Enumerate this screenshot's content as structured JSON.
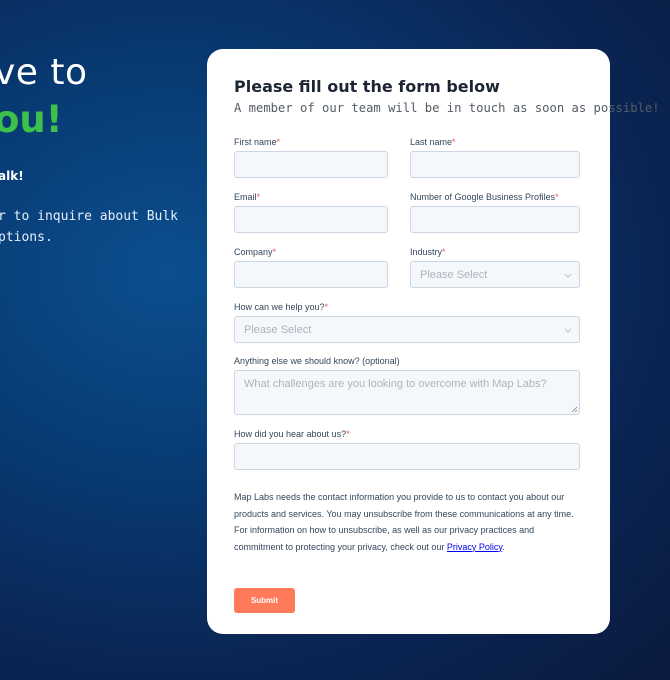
{
  "hero": {
    "line1": "ve to",
    "line2": "ou!",
    "subheading": "alk!",
    "description_line1": "r to inquire about Bulk",
    "description_line2": "ptions."
  },
  "form": {
    "title": "Please fill out the form below",
    "subtitle": "A member of our team will be in touch as soon as possible!",
    "required_marker": "*",
    "fields": {
      "first_name": {
        "label": "First name",
        "value": ""
      },
      "last_name": {
        "label": "Last name",
        "value": ""
      },
      "email": {
        "label": "Email",
        "value": ""
      },
      "profiles": {
        "label": "Number of Google Business Profiles",
        "value": ""
      },
      "company": {
        "label": "Company",
        "value": ""
      },
      "industry": {
        "label": "Industry",
        "placeholder": "Please Select"
      },
      "help": {
        "label": "How can we help you?",
        "placeholder": "Please Select"
      },
      "anything": {
        "label": "Anything else we should know? (optional)",
        "placeholder": "What challenges are you looking to overcome with Map Labs?"
      },
      "hear": {
        "label": "How did you hear about us?",
        "value": ""
      }
    },
    "privacy_text": "Map Labs needs the contact information you provide to us to contact you about our products and services. You may unsubscribe from these communications at any time. For information on how to unsubscribe, as well as our privacy practices and commitment to protecting your privacy, check out our ",
    "privacy_link": "Privacy Policy",
    "privacy_end": ".",
    "submit_label": "Submit"
  },
  "colors": {
    "accent_green": "#3ec14a",
    "submit_orange": "#ff7a59",
    "required_red": "#f2545b",
    "input_bg": "#f5f8fa"
  }
}
